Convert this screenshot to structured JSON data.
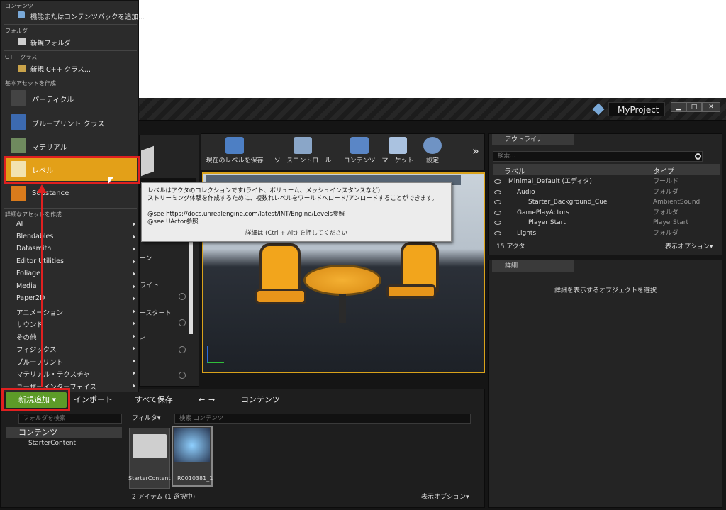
{
  "menu": {
    "sections": [
      {
        "header": "コンテンツ",
        "items": [
          "機能またはコンテンツパックを追加..."
        ]
      },
      {
        "header": "フォルダ",
        "items": [
          "新規フォルダ"
        ]
      },
      {
        "header": "C++ クラス",
        "items": [
          "新規 C++ クラス..."
        ]
      },
      {
        "header": "基本アセットを作成",
        "items": [
          "パーティクル",
          "ブループリント クラス",
          "マテリアル",
          "レベル",
          "Substance"
        ]
      },
      {
        "header": "詳細なアセットを作成",
        "items": [
          "AI",
          "Blendables",
          "Datasmith",
          "Editor Utilities",
          "Foliage",
          "Media",
          "Paper2D",
          "アニメーション",
          "サウンド",
          "その他",
          "フィジックス",
          "ブループリント",
          "マテリアル・テクスチャ",
          "ユーザーインターフェイス"
        ]
      }
    ]
  },
  "window": {
    "project": "MyProject",
    "min": "▁",
    "max": "□",
    "close": "✕"
  },
  "toolbar": {
    "save_level": "現在のレベルを保存",
    "source_control": "ソースコントロール",
    "content": "コンテンツ",
    "market": "マーケット",
    "settings": "設定",
    "more": "»"
  },
  "tooltip": {
    "line1": "レベルはアクタのコレクションです(ライト、ボリューム、メッシュインスタンスなど)",
    "line2": "ストリーミング体験を作成するために、複数れレベルをワールドへロード/アンロードすることができます。",
    "line3": "@see https://docs.unrealengine.com/latest/INT/Engine/Levels参照",
    "line4": "@see UActor参照",
    "hint": "詳細は (Ctrl + Alt) を押してください"
  },
  "modes": {
    "items": [
      "ーン",
      "ライト",
      "ースタート",
      "ィ"
    ]
  },
  "outliner": {
    "tab": "アウトライナ",
    "search_placeholder": "検索...",
    "col_label": "ラベル",
    "col_type": "タイプ",
    "rows": [
      {
        "label": "Minimal_Default (エディタ)",
        "type": "ワールド"
      },
      {
        "label": "Audio",
        "type": "フォルダ"
      },
      {
        "label": "Starter_Background_Cue",
        "type": "AmbientSound"
      },
      {
        "label": "GamePlayActors",
        "type": "フォルダ"
      },
      {
        "label": "Player Start",
        "type": "PlayerStart"
      },
      {
        "label": "Lights",
        "type": "フォルダ"
      }
    ],
    "count": "15 アクタ",
    "view_options": "表示オプション▾"
  },
  "details": {
    "tab": "詳細",
    "empty_msg": "詳細を表示するオブジェクトを選択"
  },
  "content_browser": {
    "add_new": "新規追加 ▾",
    "import": "インポート",
    "save_all": "すべて保存",
    "path": "コンテンツ",
    "folder_search": "フォルダを検索",
    "filter": "フィルタ▾",
    "content_search": "検索 コンテンツ",
    "tree_root": "コンテンツ",
    "tree_child": "StarterContent",
    "assets": [
      {
        "name": "StarterContent"
      },
      {
        "name": "R0010381_1"
      }
    ],
    "status": "2 アイテム (1 選択中)",
    "view_options": "表示オプション▾"
  },
  "colors": {
    "accent_orange": "#e3a018",
    "highlight_red": "#e02020",
    "add_green": "#5d9b28"
  }
}
